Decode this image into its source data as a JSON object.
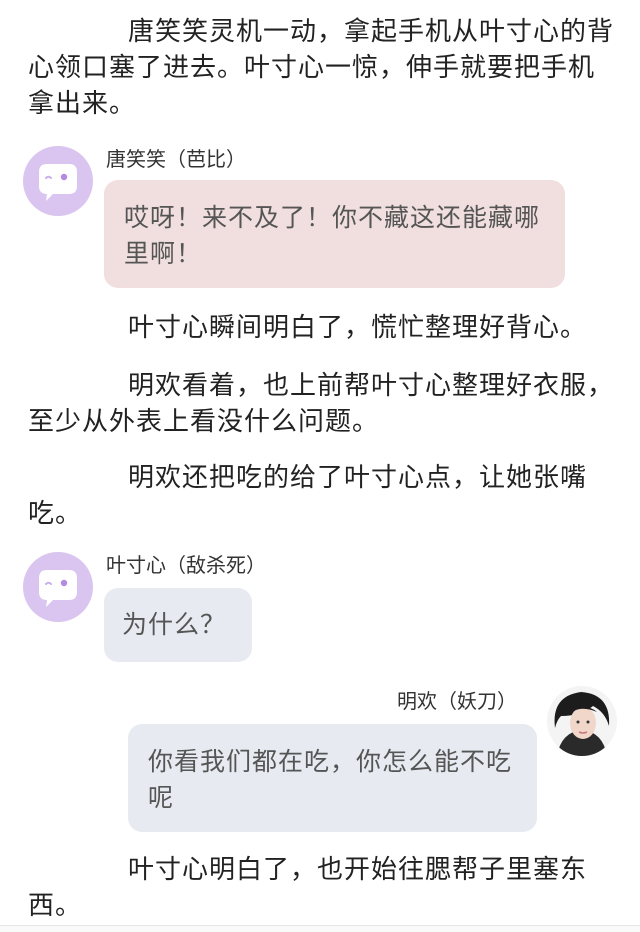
{
  "paragraphs": {
    "p1": "唐笑笑灵机一动，拿起手机从叶寸心的背心领口塞了进去。叶寸心一惊，伸手就要把手机拿出来。",
    "p2": "叶寸心瞬间明白了，慌忙整理好背心。",
    "p3": "明欢看着，也上前帮叶寸心整理好衣服，至少从外表上看没什么问题。",
    "p4": "明欢还把吃的给了叶寸心点，让她张嘴吃。",
    "p5": "叶寸心明白了，也开始往腮帮子里塞东西。"
  },
  "dialogs": {
    "d1": {
      "speaker": "唐笑笑（芭比）",
      "message": "哎呀！来不及了！你不藏这还能藏哪里啊！",
      "avatar_icon": "chat-bubble-icon"
    },
    "d2": {
      "speaker": "叶寸心（敌杀死）",
      "message": "为什么？",
      "avatar_icon": "chat-bubble-icon"
    },
    "d3": {
      "speaker": "明欢（妖刀）",
      "message": "你看我们都在吃，你怎么能不吃呢",
      "avatar_icon": "portrait-photo"
    }
  },
  "colors": {
    "avatar_purple": "#d9c5f0",
    "bubble_pink": "#f1dfdf",
    "bubble_gray": "#e7ebf1",
    "body_text": "#222222",
    "bubble_text": "#555555"
  }
}
